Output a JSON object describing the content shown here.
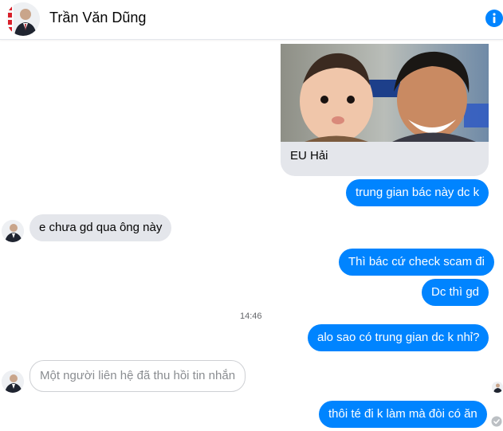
{
  "header": {
    "contact_name": "Trần Văn Dũng",
    "avatar_icon": "contact-avatar-icon",
    "info_icon": "info-icon"
  },
  "shared_card": {
    "label": "EU Hải"
  },
  "messages": [
    {
      "direction": "outgoing",
      "text": "trung gian bác này dc k"
    },
    {
      "direction": "incoming",
      "text": "e chưa gd qua ông này"
    },
    {
      "direction": "outgoing",
      "text": "Thì bác cứ check scam đi"
    },
    {
      "direction": "outgoing",
      "text": "Dc thì gd"
    },
    {
      "direction": "outgoing",
      "text": "alo sao có trung gian dc k nhỉ?"
    },
    {
      "direction": "incoming",
      "text": "Một người liên hệ đã thu hồi tin nhắn",
      "unsent": true
    },
    {
      "direction": "outgoing",
      "text": "thôi té đi k làm mà đòi có ăn"
    }
  ],
  "timestamp": "14:46",
  "colors": {
    "outgoing_bubble": "#0084ff",
    "incoming_bubble": "#e4e6eb",
    "accent": "#0084ff"
  },
  "status": {
    "seen_icon": "seen-avatar-icon",
    "delivered_icon": "check-circle-icon"
  }
}
